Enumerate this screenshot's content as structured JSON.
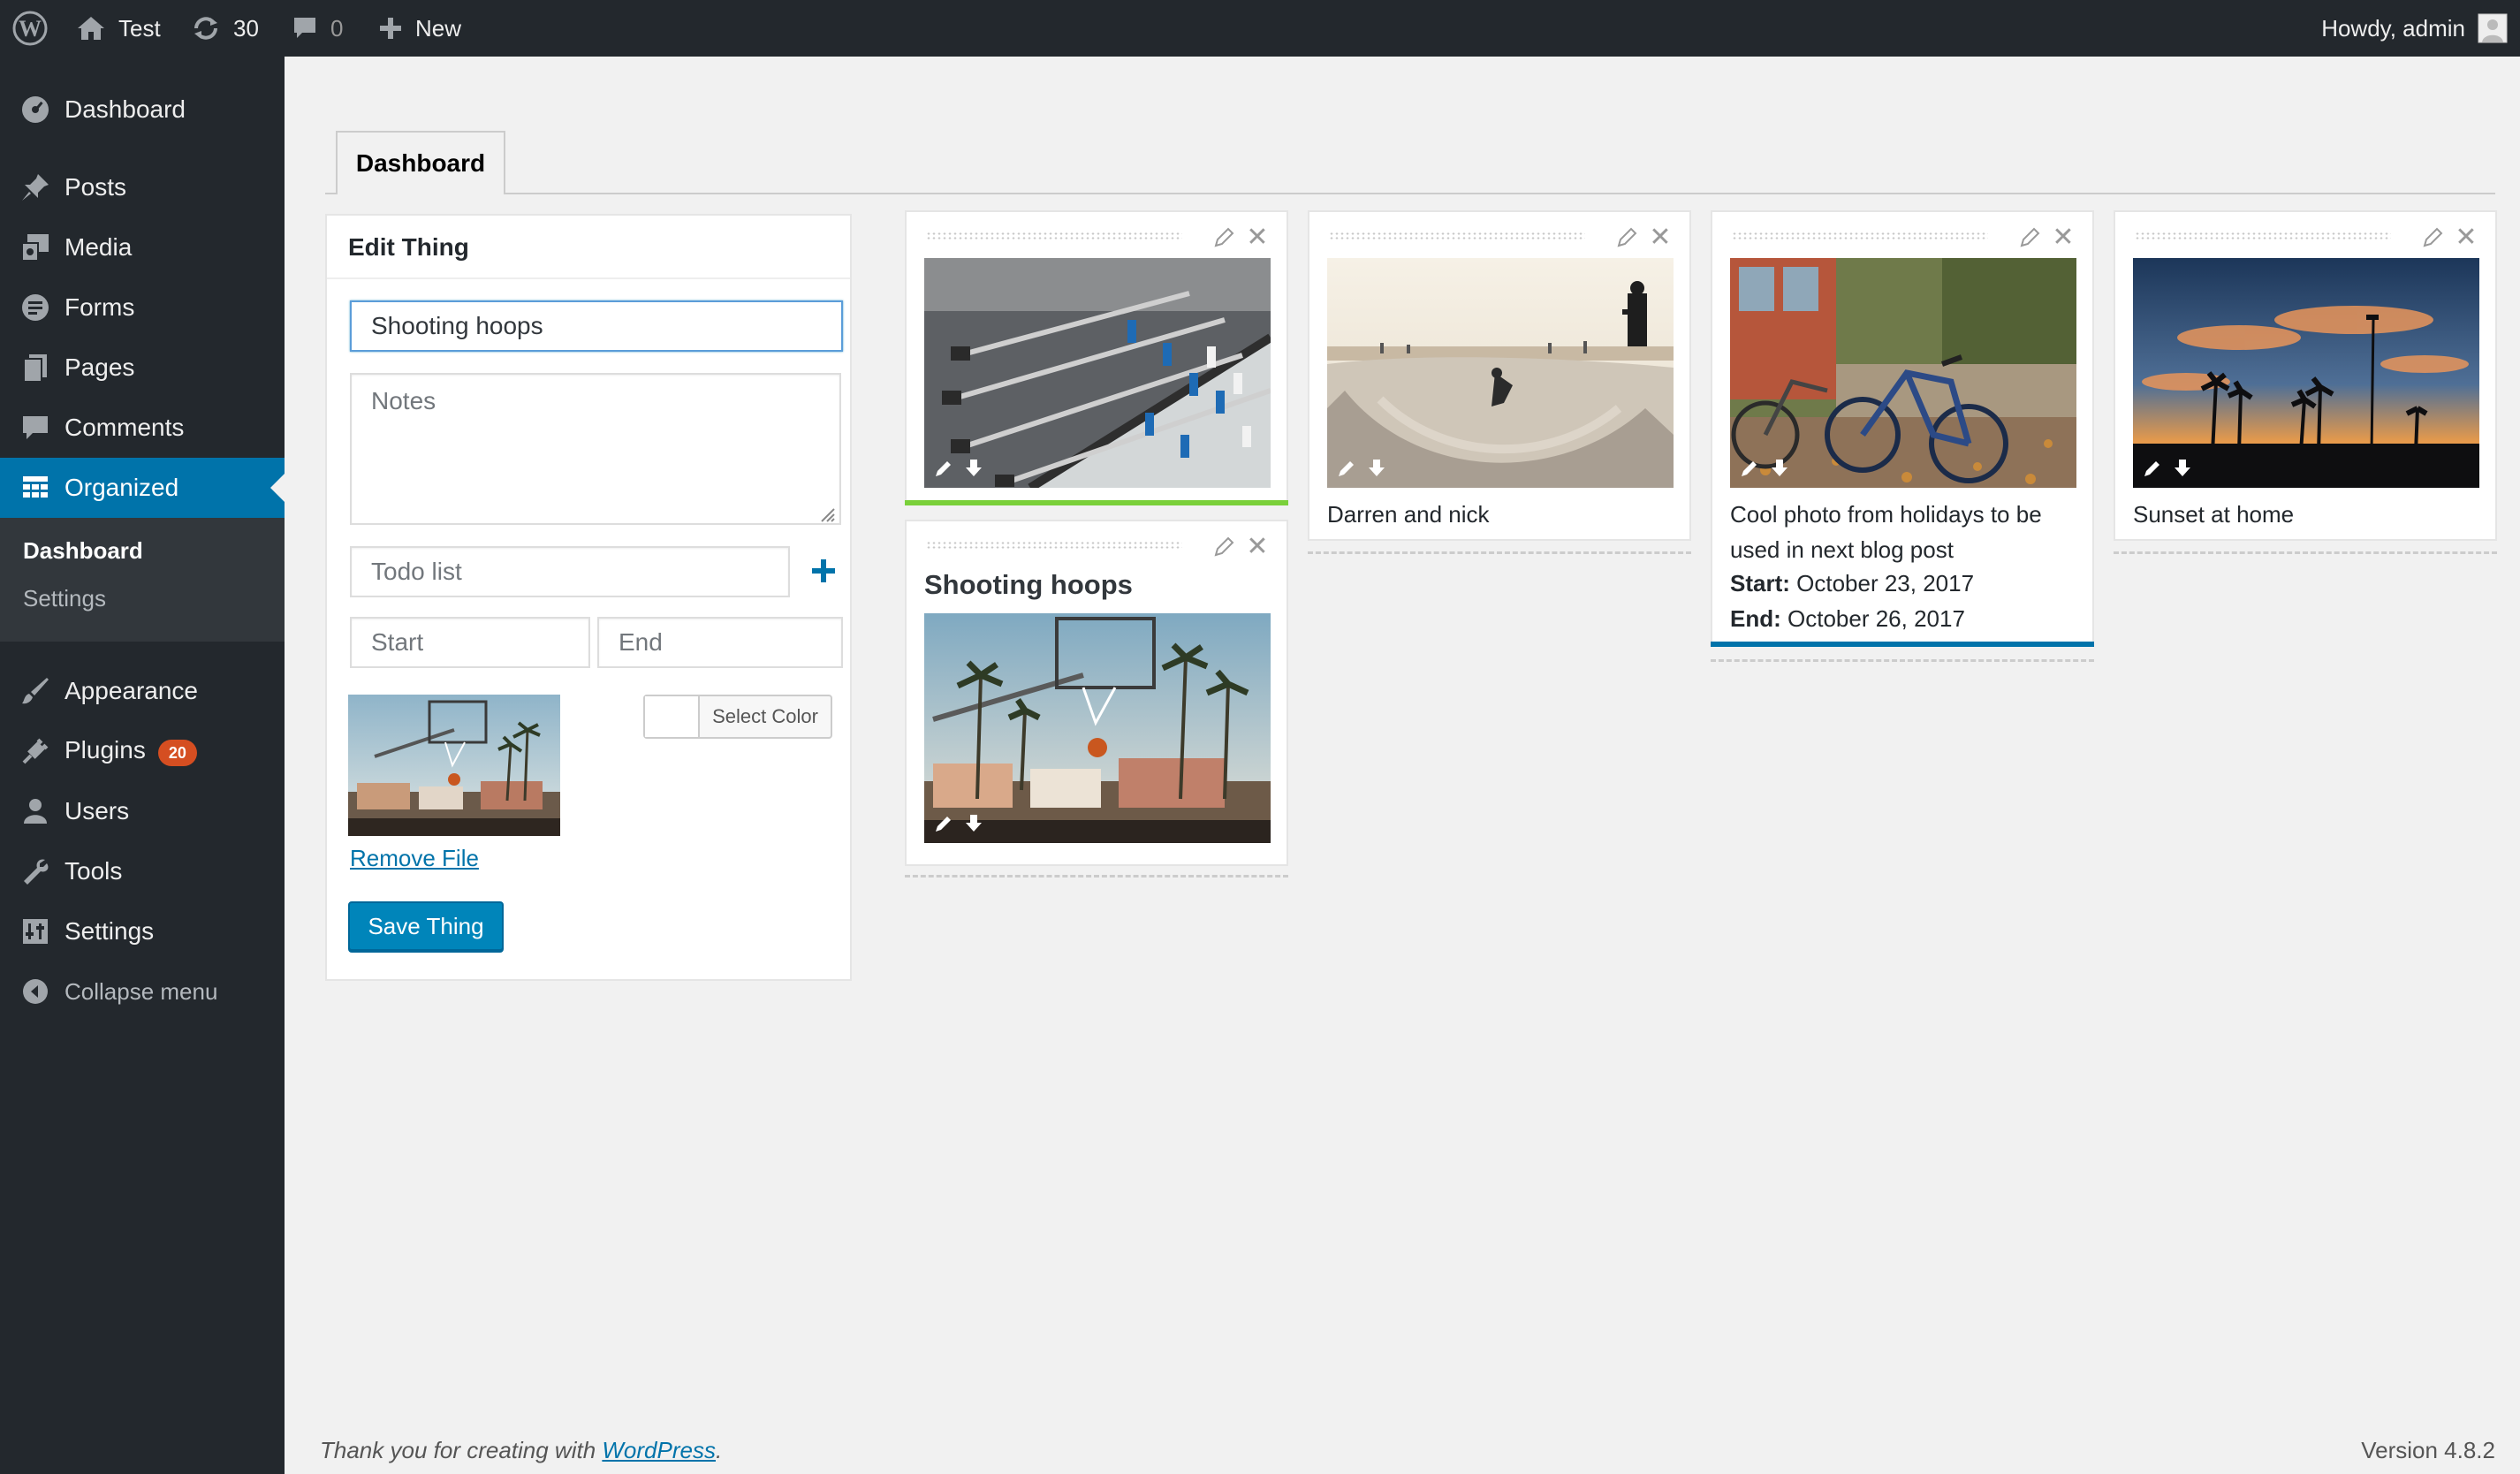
{
  "admin_bar": {
    "site_name": "Test",
    "updates_count": "30",
    "comments_count": "0",
    "new_label": "New",
    "greeting": "Howdy, admin"
  },
  "sidebar": {
    "items": [
      {
        "label": "Dashboard",
        "icon": "dashboard-icon"
      },
      {
        "label": "Posts",
        "icon": "pin-icon"
      },
      {
        "label": "Media",
        "icon": "media-icon"
      },
      {
        "label": "Forms",
        "icon": "forms-icon"
      },
      {
        "label": "Pages",
        "icon": "pages-icon"
      },
      {
        "label": "Comments",
        "icon": "comment-icon"
      },
      {
        "label": "Organized",
        "icon": "grid-icon"
      },
      {
        "label": "Appearance",
        "icon": "brush-icon"
      },
      {
        "label": "Plugins",
        "icon": "plug-icon",
        "badge": "20"
      },
      {
        "label": "Users",
        "icon": "user-icon"
      },
      {
        "label": "Tools",
        "icon": "wrench-icon"
      },
      {
        "label": "Settings",
        "icon": "settings-icon"
      }
    ],
    "submenu": [
      "Dashboard",
      "Settings"
    ],
    "collapse_label": "Collapse menu"
  },
  "tabs": {
    "active": "Dashboard"
  },
  "edit_panel": {
    "title": "Edit Thing",
    "title_value": "Shooting hoops",
    "notes_placeholder": "Notes",
    "todo_placeholder": "Todo list",
    "start_placeholder": "Start",
    "end_placeholder": "End",
    "select_color_label": "Select Color",
    "remove_file_label": "Remove File",
    "save_label": "Save Thing"
  },
  "cards": [
    {
      "name": "card-foosball",
      "image": "foosball",
      "accent": "#7ad03a"
    },
    {
      "name": "card-shooting-hoops",
      "title": "Shooting hoops",
      "image": "basketball"
    },
    {
      "name": "card-darren-and-nick",
      "caption": "Darren and nick",
      "image": "skatepark"
    },
    {
      "name": "card-holiday-photo",
      "caption": "Cool photo from holidays to be used in next blog post",
      "start_label": "Start:",
      "start_value": "October 23, 2017",
      "end_label": "End:",
      "end_value": "October 26, 2017",
      "image": "bicycles",
      "accent": "#0073aa"
    },
    {
      "name": "card-sunset",
      "caption": "Sunset at home",
      "image": "sunset"
    }
  ],
  "footer": {
    "thanks_prefix": "Thank you for creating with",
    "thanks_link": "WordPress",
    "version": "Version 4.8.2"
  },
  "colors": {
    "admin_bar_bg": "#23282d",
    "accent_blue": "#0073aa",
    "accent_green": "#7ad03a",
    "badge": "#d54e21"
  }
}
